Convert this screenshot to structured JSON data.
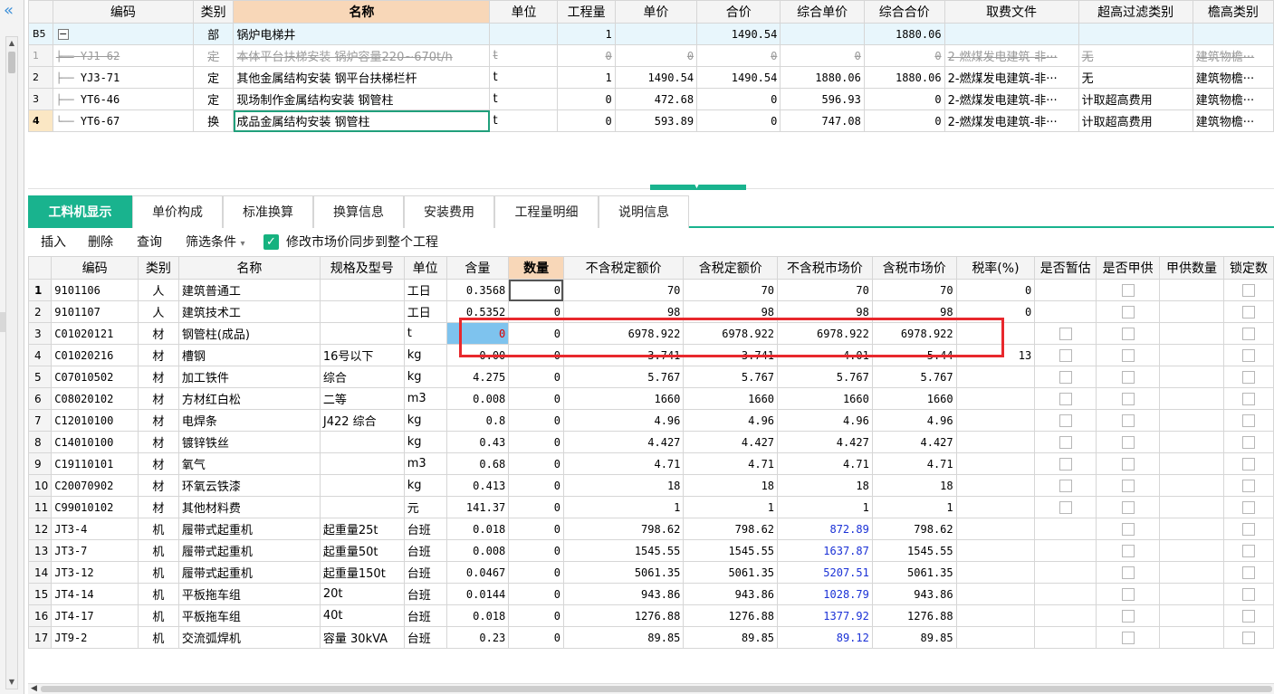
{
  "leftbar": {
    "collapse_icon": "«"
  },
  "top_table": {
    "headers": [
      "编码",
      "类别",
      "名称",
      "单位",
      "工程量",
      "单价",
      "合价",
      "综合单价",
      "综合合价",
      "取费文件",
      "超高过滤类别",
      "檐高类别"
    ],
    "rows": [
      {
        "rn": "B5",
        "code": "",
        "type": "部",
        "name": "锅炉电梯井",
        "unit": "",
        "qty": "1",
        "price": "",
        "total": "1490.54",
        "cprice": "",
        "ctotal": "1880.06",
        "file": "",
        "filter": "",
        "eave": ""
      },
      {
        "rn": "1",
        "code": "YJ1-62",
        "type": "定",
        "name": "本体平台扶梯安装 锅炉容量220~670t/h",
        "unit": "t",
        "qty": "0",
        "price": "0",
        "total": "0",
        "cprice": "0",
        "ctotal": "0",
        "file": "2-燃煤发电建筑-非···",
        "filter": "无",
        "eave": "建筑物檐···"
      },
      {
        "rn": "2",
        "code": "YJ3-71",
        "type": "定",
        "name": "其他金属结构安装 钢平台扶梯栏杆",
        "unit": "t",
        "qty": "1",
        "price": "1490.54",
        "total": "1490.54",
        "cprice": "1880.06",
        "ctotal": "1880.06",
        "file": "2-燃煤发电建筑-非···",
        "filter": "无",
        "eave": "建筑物檐···"
      },
      {
        "rn": "3",
        "code": "YT6-46",
        "type": "定",
        "name": "现场制作金属结构安装 钢管柱",
        "unit": "t",
        "qty": "0",
        "price": "472.68",
        "total": "0",
        "cprice": "596.93",
        "ctotal": "0",
        "file": "2-燃煤发电建筑-非···",
        "filter": "计取超高费用",
        "eave": "建筑物檐···"
      },
      {
        "rn": "4",
        "code": "YT6-67",
        "type": "换",
        "name": "成品金属结构安装 钢管柱",
        "unit": "t",
        "qty": "0",
        "price": "593.89",
        "total": "0",
        "cprice": "747.08",
        "ctotal": "0",
        "file": "2-燃煤发电建筑-非···",
        "filter": "计取超高费用",
        "eave": "建筑物檐···"
      }
    ]
  },
  "tabs": [
    "工料机显示",
    "单价构成",
    "标准换算",
    "换算信息",
    "安装费用",
    "工程量明细",
    "说明信息"
  ],
  "toolbar": {
    "insert": "插入",
    "delete": "删除",
    "query": "查询",
    "filter": "筛选条件",
    "filter_arrow": "▾",
    "sync_label": "修改市场价同步到整个工程",
    "check_mark": "✓"
  },
  "bottom_table": {
    "headers": [
      "编码",
      "类别",
      "名称",
      "规格及型号",
      "单位",
      "含量",
      "数量",
      "不含税定额价",
      "含税定额价",
      "不含税市场价",
      "含税市场价",
      "税率(%)",
      "是否暂估",
      "是否甲供",
      "甲供数量",
      "锁定数"
    ],
    "rows": [
      {
        "rn": "1",
        "code": "9101106",
        "type": "人",
        "name": "建筑普通工",
        "spec": "",
        "unit": "工日",
        "content": "0.3568",
        "qty": "0",
        "p1": "70",
        "p2": "70",
        "p3": "70",
        "p4": "70",
        "tax": "0"
      },
      {
        "rn": "2",
        "code": "9101107",
        "type": "人",
        "name": "建筑技术工",
        "spec": "",
        "unit": "工日",
        "content": "0.5352",
        "qty": "0",
        "p1": "98",
        "p2": "98",
        "p3": "98",
        "p4": "98",
        "tax": "0"
      },
      {
        "rn": "3",
        "code": "C01020121",
        "type": "材",
        "name": "钢管柱(成品)",
        "spec": "",
        "unit": "t",
        "content": "0",
        "qty": "0",
        "p1": "6978.922",
        "p2": "6978.922",
        "p3": "6978.922",
        "p4": "6978.922",
        "tax": ""
      },
      {
        "rn": "4",
        "code": "C01020216",
        "type": "材",
        "name": "槽钢",
        "spec": "16号以下",
        "unit": "kg",
        "content": "0.00",
        "qty": "0",
        "p1": "3.741",
        "p2": "3.741",
        "p3": "4.01",
        "p4": "5.44",
        "tax": "13"
      },
      {
        "rn": "5",
        "code": "C07010502",
        "type": "材",
        "name": "加工铁件",
        "spec": "综合",
        "unit": "kg",
        "content": "4.275",
        "qty": "0",
        "p1": "5.767",
        "p2": "5.767",
        "p3": "5.767",
        "p4": "5.767",
        "tax": ""
      },
      {
        "rn": "6",
        "code": "C08020102",
        "type": "材",
        "name": "方材红白松",
        "spec": "二等",
        "unit": "m3",
        "content": "0.008",
        "qty": "0",
        "p1": "1660",
        "p2": "1660",
        "p3": "1660",
        "p4": "1660",
        "tax": ""
      },
      {
        "rn": "7",
        "code": "C12010100",
        "type": "材",
        "name": "电焊条",
        "spec": "J422 综合",
        "unit": "kg",
        "content": "0.8",
        "qty": "0",
        "p1": "4.96",
        "p2": "4.96",
        "p3": "4.96",
        "p4": "4.96",
        "tax": ""
      },
      {
        "rn": "8",
        "code": "C14010100",
        "type": "材",
        "name": "镀锌铁丝",
        "spec": "",
        "unit": "kg",
        "content": "0.43",
        "qty": "0",
        "p1": "4.427",
        "p2": "4.427",
        "p3": "4.427",
        "p4": "4.427",
        "tax": ""
      },
      {
        "rn": "9",
        "code": "C19110101",
        "type": "材",
        "name": "氧气",
        "spec": "",
        "unit": "m3",
        "content": "0.68",
        "qty": "0",
        "p1": "4.71",
        "p2": "4.71",
        "p3": "4.71",
        "p4": "4.71",
        "tax": ""
      },
      {
        "rn": "10",
        "code": "C20070902",
        "type": "材",
        "name": "环氧云铁漆",
        "spec": "",
        "unit": "kg",
        "content": "0.413",
        "qty": "0",
        "p1": "18",
        "p2": "18",
        "p3": "18",
        "p4": "18",
        "tax": ""
      },
      {
        "rn": "11",
        "code": "C99010102",
        "type": "材",
        "name": "其他材料费",
        "spec": "",
        "unit": "元",
        "content": "141.37",
        "qty": "0",
        "p1": "1",
        "p2": "1",
        "p3": "1",
        "p4": "1",
        "tax": ""
      },
      {
        "rn": "12",
        "code": "JT3-4",
        "type": "机",
        "name": "履带式起重机",
        "spec": "起重量25t",
        "unit": "台班",
        "content": "0.018",
        "qty": "0",
        "p1": "798.62",
        "p2": "798.62",
        "p3": "872.89",
        "p4": "798.62",
        "tax": ""
      },
      {
        "rn": "13",
        "code": "JT3-7",
        "type": "机",
        "name": "履带式起重机",
        "spec": "起重量50t",
        "unit": "台班",
        "content": "0.008",
        "qty": "0",
        "p1": "1545.55",
        "p2": "1545.55",
        "p3": "1637.87",
        "p4": "1545.55",
        "tax": ""
      },
      {
        "rn": "14",
        "code": "JT3-12",
        "type": "机",
        "name": "履带式起重机",
        "spec": "起重量150t",
        "unit": "台班",
        "content": "0.0467",
        "qty": "0",
        "p1": "5061.35",
        "p2": "5061.35",
        "p3": "5207.51",
        "p4": "5061.35",
        "tax": ""
      },
      {
        "rn": "15",
        "code": "JT4-14",
        "type": "机",
        "name": "平板拖车组",
        "spec": "20t",
        "unit": "台班",
        "content": "0.0144",
        "qty": "0",
        "p1": "943.86",
        "p2": "943.86",
        "p3": "1028.79",
        "p4": "943.86",
        "tax": ""
      },
      {
        "rn": "16",
        "code": "JT4-17",
        "type": "机",
        "name": "平板拖车组",
        "spec": "40t",
        "unit": "台班",
        "content": "0.018",
        "qty": "0",
        "p1": "1276.88",
        "p2": "1276.88",
        "p3": "1377.92",
        "p4": "1276.88",
        "tax": ""
      },
      {
        "rn": "17",
        "code": "JT9-2",
        "type": "机",
        "name": "交流弧焊机",
        "spec": "容量 30kVA",
        "unit": "台班",
        "content": "0.23",
        "qty": "0",
        "p1": "89.85",
        "p2": "89.85",
        "p3": "89.12",
        "p4": "89.85",
        "tax": ""
      }
    ]
  },
  "colors": {
    "accent": "#19b38e",
    "highlight_border": "#e8282d",
    "blue_value": "#1a31d6",
    "selected_header": "#f8d7b8"
  }
}
